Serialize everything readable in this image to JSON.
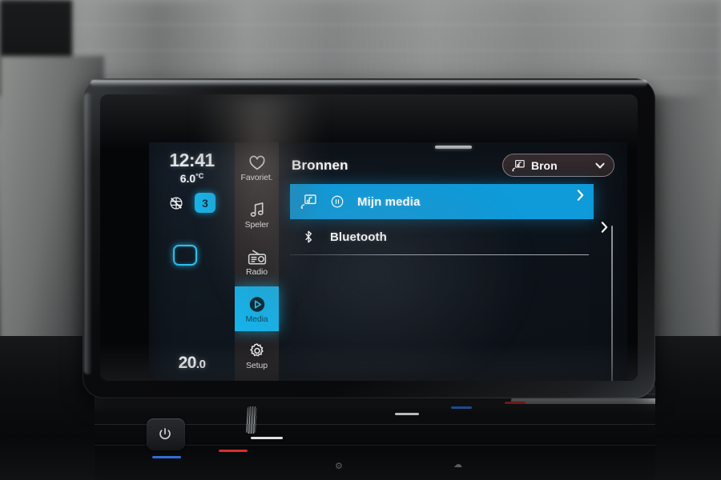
{
  "device": {
    "kind": "car-infotainment-head-unit"
  },
  "status": {
    "clock": "12:41",
    "outside_temp": "6.0",
    "outside_temp_unit": "°C",
    "fan_speed": "3",
    "set_temp_whole": "20",
    "set_temp_decimal": ".0",
    "climate_icon": "defrost-off-icon",
    "seat_icon": "seat-heating-icon"
  },
  "nav": {
    "items": [
      {
        "label": "Favoriet.",
        "icon": "heart-icon",
        "active": false
      },
      {
        "label": "Speler",
        "icon": "music-note-icon",
        "active": false
      },
      {
        "label": "Radio",
        "icon": "radio-icon",
        "active": false
      },
      {
        "label": "Media",
        "icon": "play-circle-icon",
        "active": true
      },
      {
        "label": "Setup",
        "icon": "gear-icon",
        "active": false
      }
    ]
  },
  "main": {
    "title": "Bronnen",
    "source_pill": {
      "label": "Bron",
      "icon": "media-source-icon",
      "chevron": "chevron-down-icon"
    },
    "rows": [
      {
        "label": "Mijn media",
        "icon": "media-source-icon",
        "state_icon": "pause-circle-icon",
        "chevron": "chevron-right-icon",
        "selected": true
      },
      {
        "label": "Bluetooth",
        "icon": "bluetooth-icon",
        "state_icon": "",
        "chevron": "chevron-right-icon",
        "selected": false
      }
    ]
  },
  "colors": {
    "accent_cyan": "#18b2e8",
    "row_highlight_blue": "#0f9ad9",
    "screen_background": "#0e141b",
    "rail_background": "#262325",
    "text_primary": "#ffffff"
  }
}
